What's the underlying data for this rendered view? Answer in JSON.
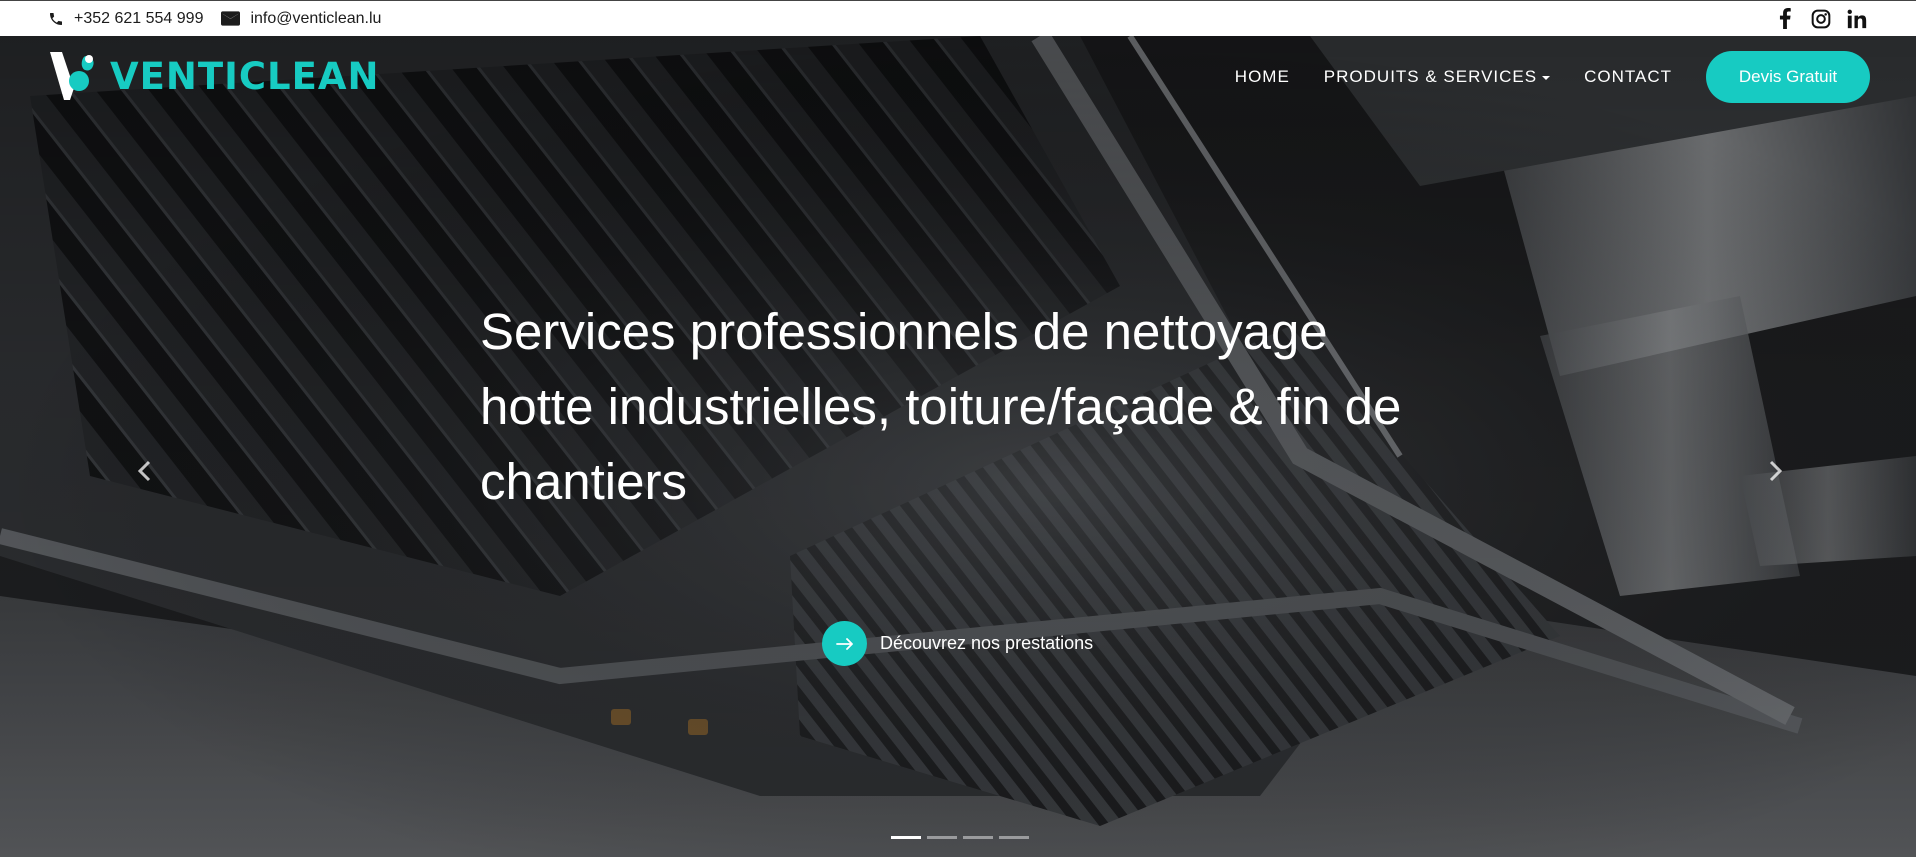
{
  "topbar": {
    "phone": "+352 621 554 999",
    "email": "info@venticlean.lu",
    "socials": [
      {
        "name": "facebook-icon"
      },
      {
        "name": "instagram-icon"
      },
      {
        "name": "linkedin-icon"
      }
    ]
  },
  "header": {
    "logo_text": "VENTICLEAN",
    "nav": {
      "home": "HOME",
      "products": "PRODUITS & SERVICES",
      "contact": "CONTACT"
    },
    "cta": "Devis Gratuit"
  },
  "hero": {
    "title": "Services professionnels de nettoyage hotte industrielles, toiture/façade & fin de chantiers",
    "cta": "Découvrez nos prestations",
    "slides_count": 4,
    "active_slide": 1
  },
  "colors": {
    "accent": "#17cbc2",
    "text_light": "#ffffff",
    "topbar_bg": "#ffffff",
    "hero_bg": "#1d1e20"
  }
}
